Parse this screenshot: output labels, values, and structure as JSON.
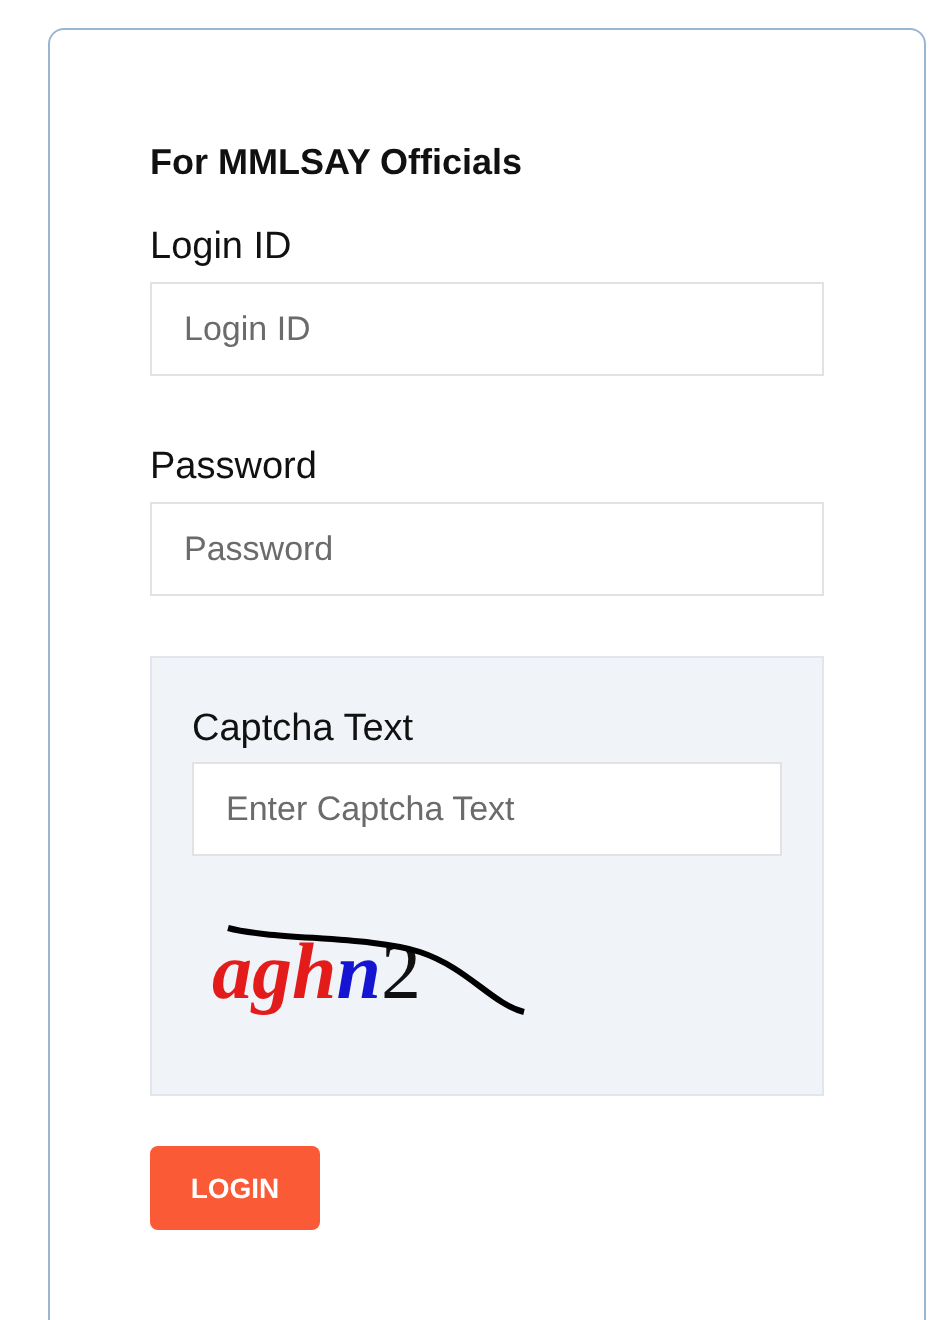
{
  "heading": "For MMLSAY Officials",
  "fields": [
    {
      "label": "Login ID",
      "placeholder": "Login ID"
    },
    {
      "label": "Password",
      "placeholder": "Password"
    }
  ],
  "captcha": {
    "label": "Captcha Text",
    "placeholder": "Enter Captcha Text",
    "chars": [
      {
        "char": "a",
        "color": "#e31b1b"
      },
      {
        "char": "g",
        "color": "#e31b1b"
      },
      {
        "char": "h",
        "color": "#e31b1b"
      },
      {
        "char": "n",
        "color": "#1414d2"
      },
      {
        "char": "2",
        "color": "#111111"
      }
    ]
  },
  "button": "LOGIN"
}
